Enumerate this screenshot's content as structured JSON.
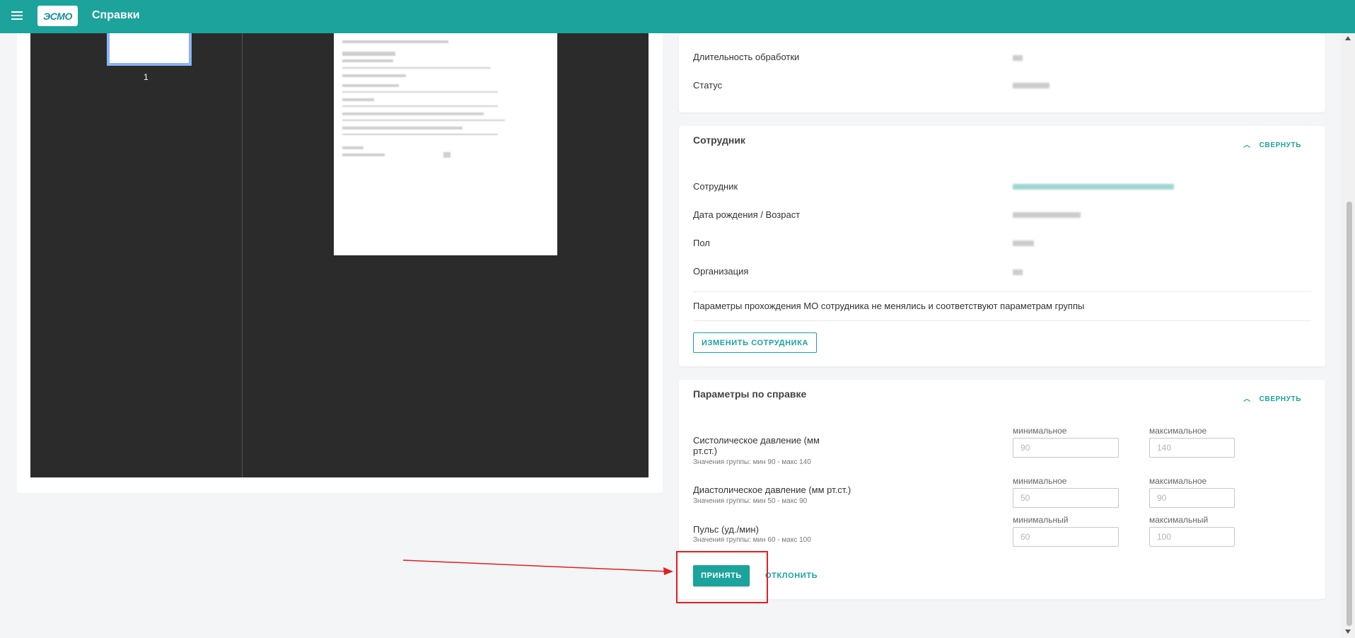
{
  "header": {
    "logo_text": "ЭСМО",
    "title": "Справки"
  },
  "viewer": {
    "page_number": "1"
  },
  "processing_card": {
    "rows": [
      {
        "label": "Длительность обработки"
      },
      {
        "label": "Статус"
      }
    ]
  },
  "employee_card": {
    "title": "Сотрудник",
    "collapse_label": "СВЕРНУТЬ",
    "rows": [
      {
        "label": "Сотрудник"
      },
      {
        "label": "Дата рождения / Возраст"
      },
      {
        "label": "Пол"
      },
      {
        "label": "Организация"
      }
    ],
    "info_text": "Параметры прохождения МО сотрудника не менялись и соответствуют параметрам группы",
    "change_button": "ИЗМЕНИТЬ СОТРУДНИКА"
  },
  "params_card": {
    "title": "Параметры по справке",
    "collapse_label": "СВЕРНУТЬ",
    "params": [
      {
        "label": "Систолическое давление (мм рт.ст.)",
        "hint": "Значения группы: мин 90 - макс 140",
        "min_caption": "минимальное",
        "max_caption": "максимальное",
        "min_placeholder": "90",
        "max_placeholder": "140"
      },
      {
        "label": "Диастолическое давление (мм рт.ст.)",
        "hint": "Значения группы: мин 50 - макс 90",
        "min_caption": "минимальное",
        "max_caption": "максимальное",
        "min_placeholder": "50",
        "max_placeholder": "90"
      },
      {
        "label": "Пульс (уд./мин)",
        "hint": "Значения группы: мин 60 - макс 100",
        "min_caption": "минимальный",
        "max_caption": "максимальный",
        "min_placeholder": "60",
        "max_placeholder": "100"
      }
    ],
    "accept_button": "ПРИНЯТЬ",
    "reject_button": "ОТКЛОНИТЬ"
  },
  "colors": {
    "brand": "#1ba39c",
    "annotation": "#e02020"
  }
}
